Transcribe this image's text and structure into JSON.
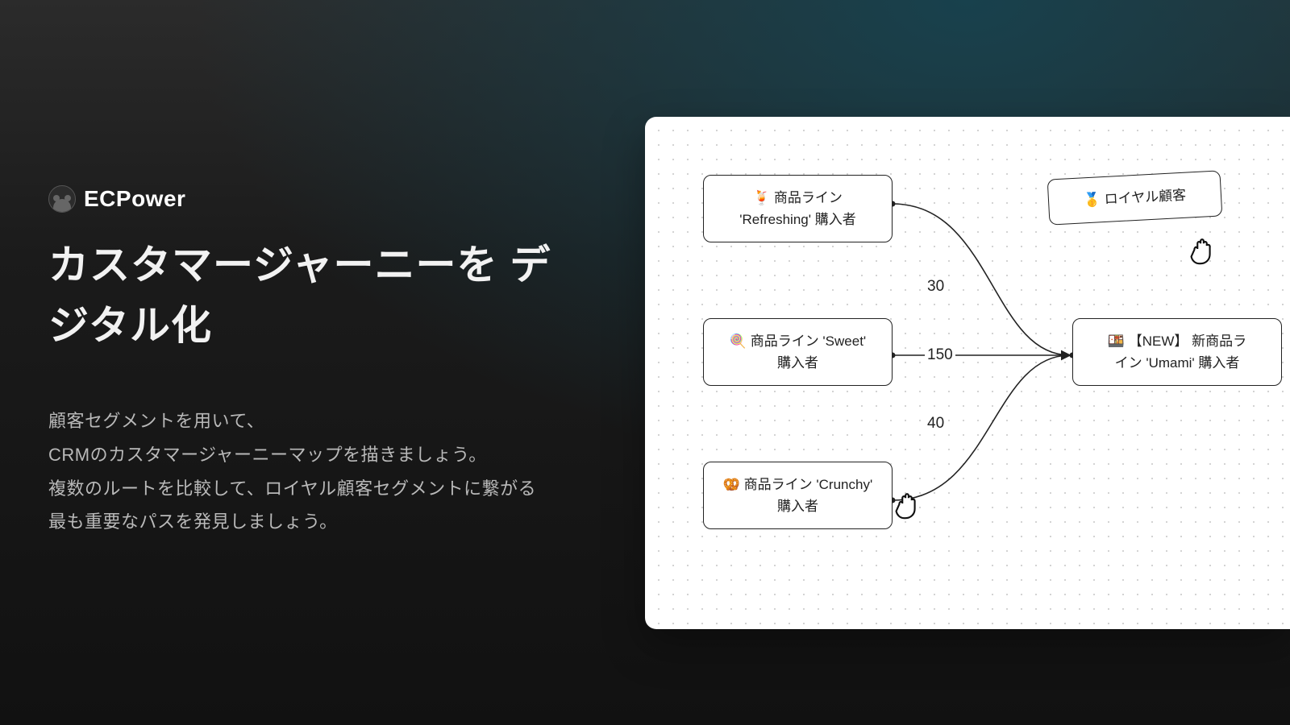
{
  "brand": {
    "name": "ECPower"
  },
  "headline": "カスタマージャーニーを\nデジタル化",
  "subtitle": "顧客セグメントを用いて、\nCRMのカスタマージャーニーマップを描きましょう。\n複数のルートを比較して、ロイヤル顧客セグメントに繋がる\n最も重要なパスを発見しましょう。",
  "diagram": {
    "nodes": {
      "refreshing": "🍹 商品ライン\n'Refreshing' 購入者",
      "sweet": "🍭 商品ライン 'Sweet'\n購入者",
      "crunchy": "🥨 商品ライン 'Crunchy'\n購入者",
      "loyal": "🥇 ロイヤル顧客",
      "umami": "🍱 【NEW】 新商品ラ\nイン 'Umami' 購入者"
    },
    "edges": {
      "e1": "30",
      "e2": "150",
      "e3": "40"
    }
  }
}
